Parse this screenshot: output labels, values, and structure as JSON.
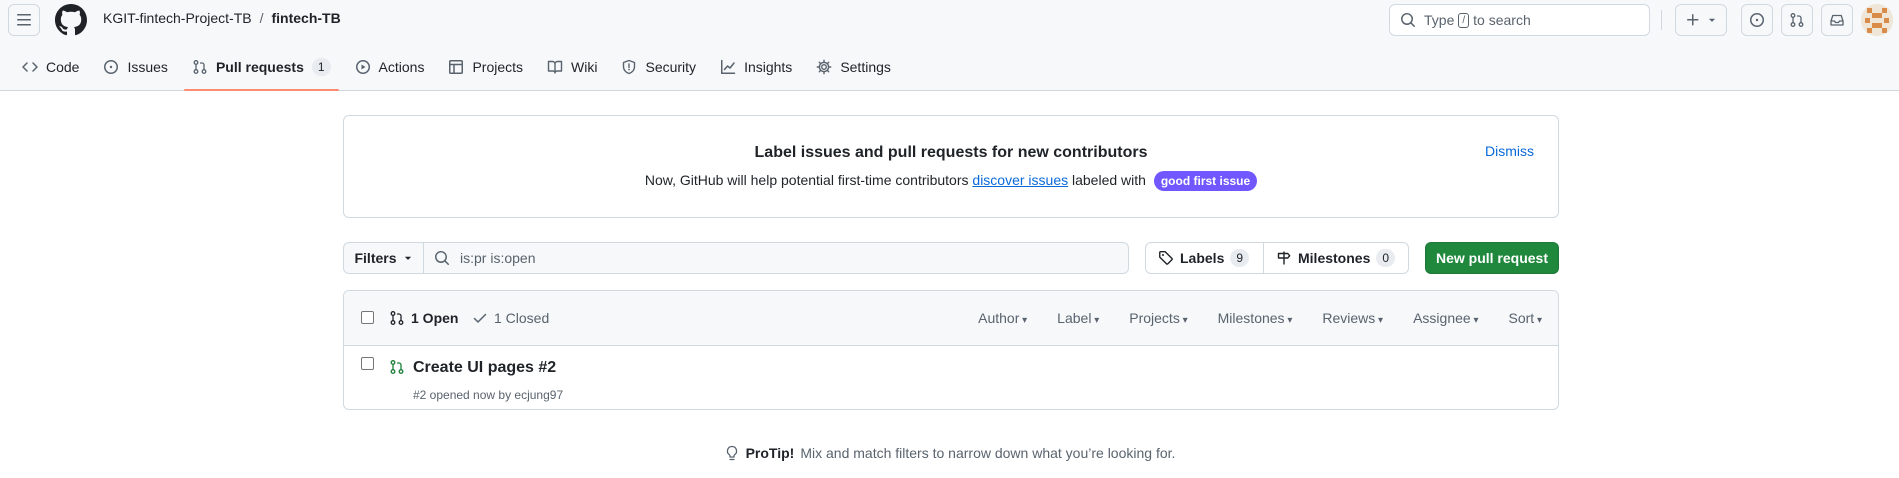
{
  "header": {
    "owner": "KGIT-fintech-Project-TB",
    "separator": "/",
    "repo": "fintech-TB",
    "search": {
      "prefix": "Type",
      "key": "/",
      "suffix": "to search"
    }
  },
  "tabs": [
    {
      "label": "Code",
      "icon": "code-icon"
    },
    {
      "label": "Issues",
      "icon": "issue-icon"
    },
    {
      "label": "Pull requests",
      "icon": "pull-request-icon",
      "count": "1",
      "active": true
    },
    {
      "label": "Actions",
      "icon": "play-icon"
    },
    {
      "label": "Projects",
      "icon": "table-icon"
    },
    {
      "label": "Wiki",
      "icon": "book-icon"
    },
    {
      "label": "Security",
      "icon": "shield-icon"
    },
    {
      "label": "Insights",
      "icon": "graph-icon"
    },
    {
      "label": "Settings",
      "icon": "gear-icon"
    }
  ],
  "banner": {
    "title": "Label issues and pull requests for new contributors",
    "desc_before": "Now, GitHub will help potential first-time contributors",
    "desc_link": "discover issues",
    "desc_after": "labeled with",
    "label": "good first issue",
    "dismiss": "Dismiss"
  },
  "filter_bar": {
    "filters_label": "Filters",
    "query": "is:pr is:open",
    "labels_label": "Labels",
    "labels_count": "9",
    "milestones_label": "Milestones",
    "milestones_count": "0",
    "new_pr_label": "New pull request"
  },
  "list": {
    "open_label": "1 Open",
    "closed_label": "1 Closed",
    "sort_options": [
      "Author",
      "Label",
      "Projects",
      "Milestones",
      "Reviews",
      "Assignee",
      "Sort"
    ],
    "rows": [
      {
        "title": "Create UI pages #2",
        "meta": "#2 opened now by ecjung97"
      }
    ]
  },
  "protip": {
    "bold": "ProTip!",
    "text": "Mix and match filters to narrow down what you’re looking for."
  },
  "colors": {
    "accent": "#fd8c73",
    "green": "#1f883d",
    "link": "#0969da",
    "label": "#7057ff"
  }
}
